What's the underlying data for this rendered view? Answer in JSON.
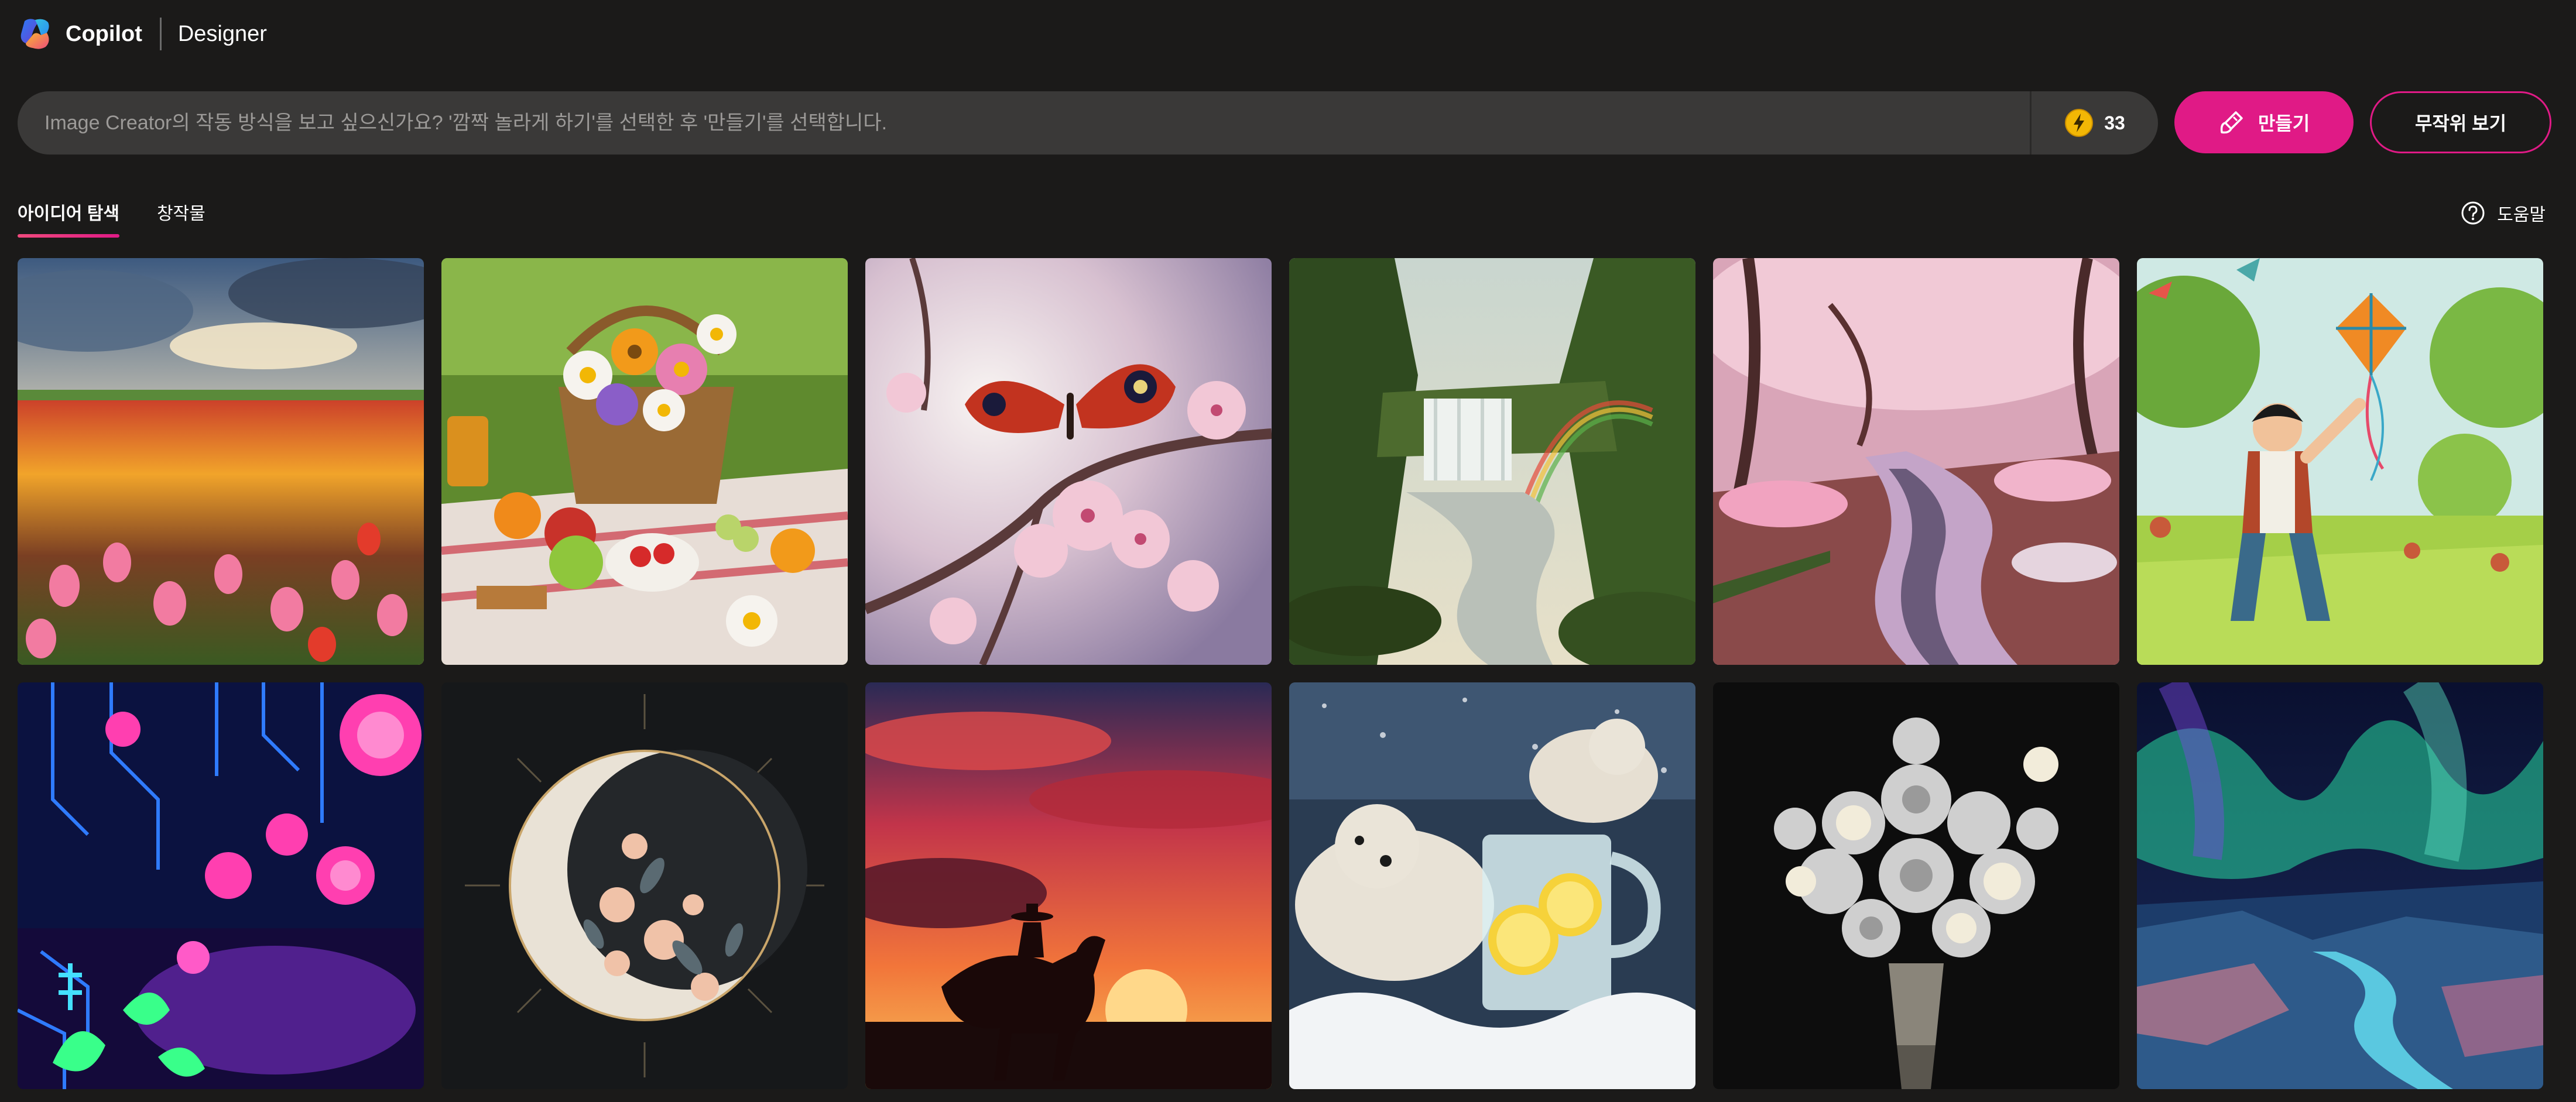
{
  "header": {
    "brand": "Copilot",
    "product": "Designer"
  },
  "prompt": {
    "placeholder": "Image Creator의 작동 방식을 보고 싶으신가요? '깜짝 놀라게 하기'를 선택한 후 '만들기'를 선택합니다.",
    "value": "",
    "boost_count": "33"
  },
  "buttons": {
    "create": "만들기",
    "surprise": "무작위 보기"
  },
  "tabs": [
    {
      "label": "아이디어 탐색",
      "active": true
    },
    {
      "label": "창작물",
      "active": false
    }
  ],
  "help": {
    "label": "도움말"
  },
  "colors": {
    "background": "#1b1a19",
    "prompt_bar": "#3a3938",
    "accent": "#e01a86",
    "placeholder": "#9c9a98"
  },
  "icons": {
    "logo": "copilot-logo-icon",
    "boost": "lightning-boost-icon",
    "create": "brush-create-icon",
    "help": "question-circle-icon"
  }
}
